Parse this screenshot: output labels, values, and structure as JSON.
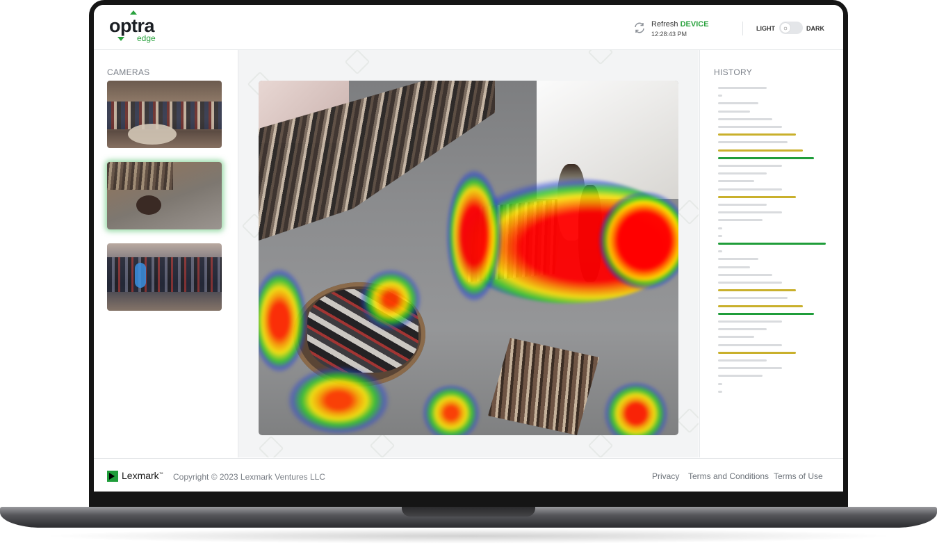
{
  "header": {
    "logo_main": "optra",
    "logo_sub": "edge",
    "refresh_label": "Refresh",
    "refresh_device": "DEVICE",
    "refresh_time": "12:28:43 PM",
    "theme_light": "LIGHT",
    "theme_dark": "DARK",
    "theme_selected": "light"
  },
  "cameras": {
    "title": "CAMERAS",
    "selected_index": 1,
    "count": 3
  },
  "history": {
    "title": "HISTORY",
    "colors": {
      "default": "#d9dbde",
      "warning": "#c9b02c",
      "active": "#1f9d3a"
    },
    "entries": [
      {
        "w": 70,
        "c": "default"
      },
      {
        "w": 6,
        "c": "default"
      },
      {
        "w": 58,
        "c": "default"
      },
      {
        "w": 46,
        "c": "default"
      },
      {
        "w": 78,
        "c": "default"
      },
      {
        "w": 92,
        "c": "default"
      },
      {
        "w": 112,
        "c": "warning"
      },
      {
        "w": 100,
        "c": "default"
      },
      {
        "w": 122,
        "c": "warning"
      },
      {
        "w": 138,
        "c": "active"
      },
      {
        "w": 92,
        "c": "default"
      },
      {
        "w": 70,
        "c": "default"
      },
      {
        "w": 52,
        "c": "default"
      },
      {
        "w": 92,
        "c": "default"
      },
      {
        "w": 112,
        "c": "warning"
      },
      {
        "w": 70,
        "c": "default"
      },
      {
        "w": 92,
        "c": "default"
      },
      {
        "w": 64,
        "c": "default"
      },
      {
        "w": 6,
        "c": "default"
      },
      {
        "w": 6,
        "c": "default"
      },
      {
        "w": 155,
        "c": "active"
      },
      {
        "w": 6,
        "c": "default"
      },
      {
        "w": 58,
        "c": "default"
      },
      {
        "w": 46,
        "c": "default"
      },
      {
        "w": 78,
        "c": "default"
      },
      {
        "w": 92,
        "c": "default"
      },
      {
        "w": 112,
        "c": "warning"
      },
      {
        "w": 100,
        "c": "default"
      },
      {
        "w": 122,
        "c": "warning"
      },
      {
        "w": 138,
        "c": "active"
      },
      {
        "w": 92,
        "c": "default"
      },
      {
        "w": 70,
        "c": "default"
      },
      {
        "w": 52,
        "c": "default"
      },
      {
        "w": 92,
        "c": "default"
      },
      {
        "w": 112,
        "c": "warning"
      },
      {
        "w": 70,
        "c": "default"
      },
      {
        "w": 92,
        "c": "default"
      },
      {
        "w": 64,
        "c": "default"
      },
      {
        "w": 6,
        "c": "default"
      },
      {
        "w": 6,
        "c": "default"
      }
    ]
  },
  "footer": {
    "brand": "Lexmark",
    "brand_mark": "™",
    "copyright": "Copyright © 2023 Lexmark Ventures LLC",
    "links": [
      "Privacy",
      "Terms and Conditions",
      "Terms of Use"
    ]
  },
  "colors": {
    "accent": "#2aa23e",
    "brand_green": "#1f9d3a"
  }
}
